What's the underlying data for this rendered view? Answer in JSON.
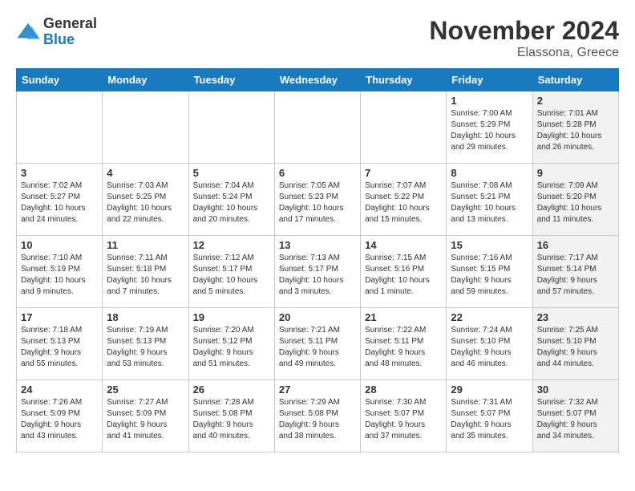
{
  "header": {
    "logo_general": "General",
    "logo_blue": "Blue",
    "month_title": "November 2024",
    "subtitle": "Elassona, Greece"
  },
  "weekdays": [
    "Sunday",
    "Monday",
    "Tuesday",
    "Wednesday",
    "Thursday",
    "Friday",
    "Saturday"
  ],
  "weeks": [
    [
      {
        "day": "",
        "info": "",
        "shaded": false
      },
      {
        "day": "",
        "info": "",
        "shaded": false
      },
      {
        "day": "",
        "info": "",
        "shaded": false
      },
      {
        "day": "",
        "info": "",
        "shaded": false
      },
      {
        "day": "",
        "info": "",
        "shaded": false
      },
      {
        "day": "1",
        "info": "Sunrise: 7:00 AM\nSunset: 5:29 PM\nDaylight: 10 hours\nand 29 minutes.",
        "shaded": false
      },
      {
        "day": "2",
        "info": "Sunrise: 7:01 AM\nSunset: 5:28 PM\nDaylight: 10 hours\nand 26 minutes.",
        "shaded": true
      }
    ],
    [
      {
        "day": "3",
        "info": "Sunrise: 7:02 AM\nSunset: 5:27 PM\nDaylight: 10 hours\nand 24 minutes.",
        "shaded": false
      },
      {
        "day": "4",
        "info": "Sunrise: 7:03 AM\nSunset: 5:25 PM\nDaylight: 10 hours\nand 22 minutes.",
        "shaded": false
      },
      {
        "day": "5",
        "info": "Sunrise: 7:04 AM\nSunset: 5:24 PM\nDaylight: 10 hours\nand 20 minutes.",
        "shaded": false
      },
      {
        "day": "6",
        "info": "Sunrise: 7:05 AM\nSunset: 5:23 PM\nDaylight: 10 hours\nand 17 minutes.",
        "shaded": false
      },
      {
        "day": "7",
        "info": "Sunrise: 7:07 AM\nSunset: 5:22 PM\nDaylight: 10 hours\nand 15 minutes.",
        "shaded": false
      },
      {
        "day": "8",
        "info": "Sunrise: 7:08 AM\nSunset: 5:21 PM\nDaylight: 10 hours\nand 13 minutes.",
        "shaded": false
      },
      {
        "day": "9",
        "info": "Sunrise: 7:09 AM\nSunset: 5:20 PM\nDaylight: 10 hours\nand 11 minutes.",
        "shaded": true
      }
    ],
    [
      {
        "day": "10",
        "info": "Sunrise: 7:10 AM\nSunset: 5:19 PM\nDaylight: 10 hours\nand 9 minutes.",
        "shaded": false
      },
      {
        "day": "11",
        "info": "Sunrise: 7:11 AM\nSunset: 5:18 PM\nDaylight: 10 hours\nand 7 minutes.",
        "shaded": false
      },
      {
        "day": "12",
        "info": "Sunrise: 7:12 AM\nSunset: 5:17 PM\nDaylight: 10 hours\nand 5 minutes.",
        "shaded": false
      },
      {
        "day": "13",
        "info": "Sunrise: 7:13 AM\nSunset: 5:17 PM\nDaylight: 10 hours\nand 3 minutes.",
        "shaded": false
      },
      {
        "day": "14",
        "info": "Sunrise: 7:15 AM\nSunset: 5:16 PM\nDaylight: 10 hours\nand 1 minute.",
        "shaded": false
      },
      {
        "day": "15",
        "info": "Sunrise: 7:16 AM\nSunset: 5:15 PM\nDaylight: 9 hours\nand 59 minutes.",
        "shaded": false
      },
      {
        "day": "16",
        "info": "Sunrise: 7:17 AM\nSunset: 5:14 PM\nDaylight: 9 hours\nand 57 minutes.",
        "shaded": true
      }
    ],
    [
      {
        "day": "17",
        "info": "Sunrise: 7:18 AM\nSunset: 5:13 PM\nDaylight: 9 hours\nand 55 minutes.",
        "shaded": false
      },
      {
        "day": "18",
        "info": "Sunrise: 7:19 AM\nSunset: 5:13 PM\nDaylight: 9 hours\nand 53 minutes.",
        "shaded": false
      },
      {
        "day": "19",
        "info": "Sunrise: 7:20 AM\nSunset: 5:12 PM\nDaylight: 9 hours\nand 51 minutes.",
        "shaded": false
      },
      {
        "day": "20",
        "info": "Sunrise: 7:21 AM\nSunset: 5:11 PM\nDaylight: 9 hours\nand 49 minutes.",
        "shaded": false
      },
      {
        "day": "21",
        "info": "Sunrise: 7:22 AM\nSunset: 5:11 PM\nDaylight: 9 hours\nand 48 minutes.",
        "shaded": false
      },
      {
        "day": "22",
        "info": "Sunrise: 7:24 AM\nSunset: 5:10 PM\nDaylight: 9 hours\nand 46 minutes.",
        "shaded": false
      },
      {
        "day": "23",
        "info": "Sunrise: 7:25 AM\nSunset: 5:10 PM\nDaylight: 9 hours\nand 44 minutes.",
        "shaded": true
      }
    ],
    [
      {
        "day": "24",
        "info": "Sunrise: 7:26 AM\nSunset: 5:09 PM\nDaylight: 9 hours\nand 43 minutes.",
        "shaded": false
      },
      {
        "day": "25",
        "info": "Sunrise: 7:27 AM\nSunset: 5:09 PM\nDaylight: 9 hours\nand 41 minutes.",
        "shaded": false
      },
      {
        "day": "26",
        "info": "Sunrise: 7:28 AM\nSunset: 5:08 PM\nDaylight: 9 hours\nand 40 minutes.",
        "shaded": false
      },
      {
        "day": "27",
        "info": "Sunrise: 7:29 AM\nSunset: 5:08 PM\nDaylight: 9 hours\nand 38 minutes.",
        "shaded": false
      },
      {
        "day": "28",
        "info": "Sunrise: 7:30 AM\nSunset: 5:07 PM\nDaylight: 9 hours\nand 37 minutes.",
        "shaded": false
      },
      {
        "day": "29",
        "info": "Sunrise: 7:31 AM\nSunset: 5:07 PM\nDaylight: 9 hours\nand 35 minutes.",
        "shaded": false
      },
      {
        "day": "30",
        "info": "Sunrise: 7:32 AM\nSunset: 5:07 PM\nDaylight: 9 hours\nand 34 minutes.",
        "shaded": true
      }
    ]
  ]
}
